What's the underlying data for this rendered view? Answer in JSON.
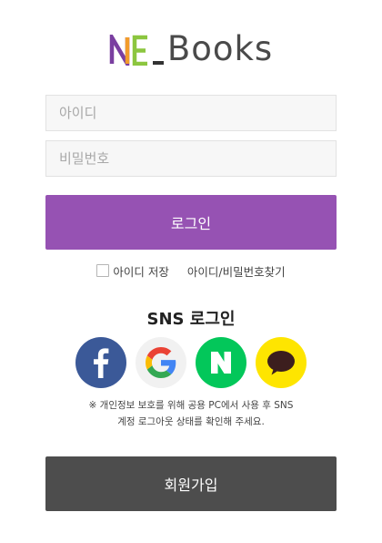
{
  "brand": {
    "logo_text": "Books",
    "logo_mark": "NE_",
    "colors": {
      "n": "#7a3fa0",
      "e": "#8cc63f",
      "underscore": "#333333"
    }
  },
  "login_form": {
    "id_placeholder": "아이디",
    "password_placeholder": "비밀번호",
    "login_label": "로그인",
    "save_id_label": "아이디 저장",
    "find_link_label": "아이디/비밀번호찾기",
    "accent_color": "#9652b3"
  },
  "sns": {
    "title": "SNS 로그인",
    "providers": [
      {
        "name": "facebook",
        "icon": "facebook-icon",
        "color": "#3b5998"
      },
      {
        "name": "google",
        "icon": "google-icon",
        "color": "#f1f1f1"
      },
      {
        "name": "naver",
        "icon": "naver-icon",
        "color": "#03c75a"
      },
      {
        "name": "kakao",
        "icon": "kakao-icon",
        "color": "#fee500"
      }
    ],
    "notice_line1": "※ 개인정보 보호를 위해 공용 PC에서 사용 후 SNS",
    "notice_line2": "계정 로그아웃 상태를 확인해 주세요."
  },
  "signup": {
    "label": "회원가입",
    "color": "#4d4d4d"
  }
}
